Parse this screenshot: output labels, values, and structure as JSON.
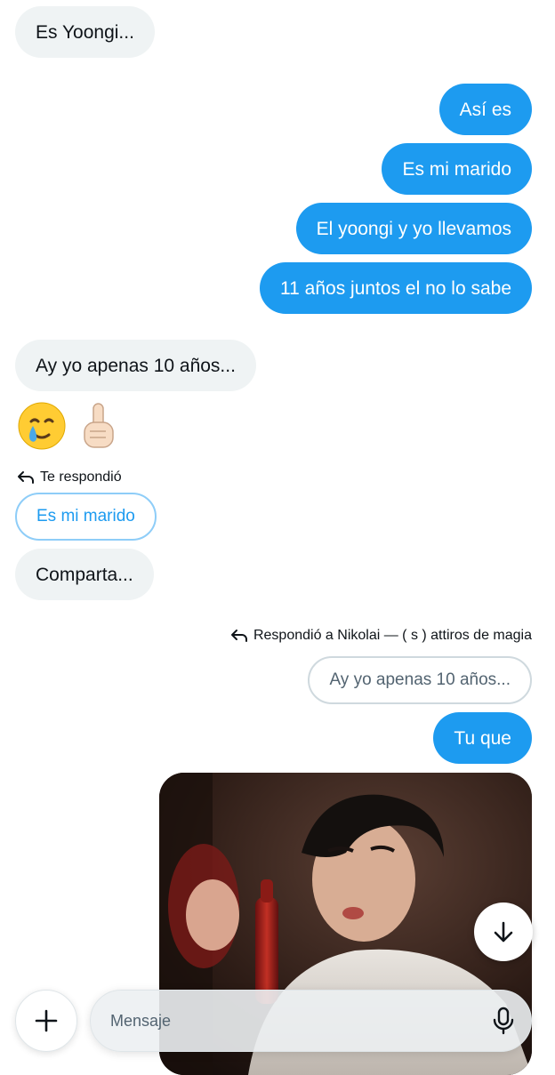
{
  "messages": [
    {
      "text": "Es Yoongi..."
    },
    {
      "text": "Así es"
    },
    {
      "text": "Es mi marido"
    },
    {
      "text": "El yoongi y yo llevamos"
    },
    {
      "text": "11 años juntos el no lo sabe"
    },
    {
      "text": "Ay yo apenas 10 años..."
    },
    {
      "text": "Comparta..."
    },
    {
      "text": "Tu que"
    }
  ],
  "emojis": [
    "face-holding-back-tears",
    "index-pointing-up"
  ],
  "reply_left": {
    "label": "Te respondió",
    "quote": "Es mi marido"
  },
  "reply_right": {
    "label": "Respondió a Nikolai — ( s ) attiros de magia",
    "quote": "Ay yo apenas 10 años..."
  },
  "composer": {
    "placeholder": "Mensaje"
  },
  "icons": {
    "scroll_down": "arrow-down-icon",
    "add": "plus-icon",
    "mic": "microphone-icon",
    "reply": "reply-arrow-icon"
  },
  "colors": {
    "outgoing_bubble": "#1d9bf0",
    "incoming_bubble": "#eff3f4",
    "quote_link": "#1d9bf0"
  }
}
